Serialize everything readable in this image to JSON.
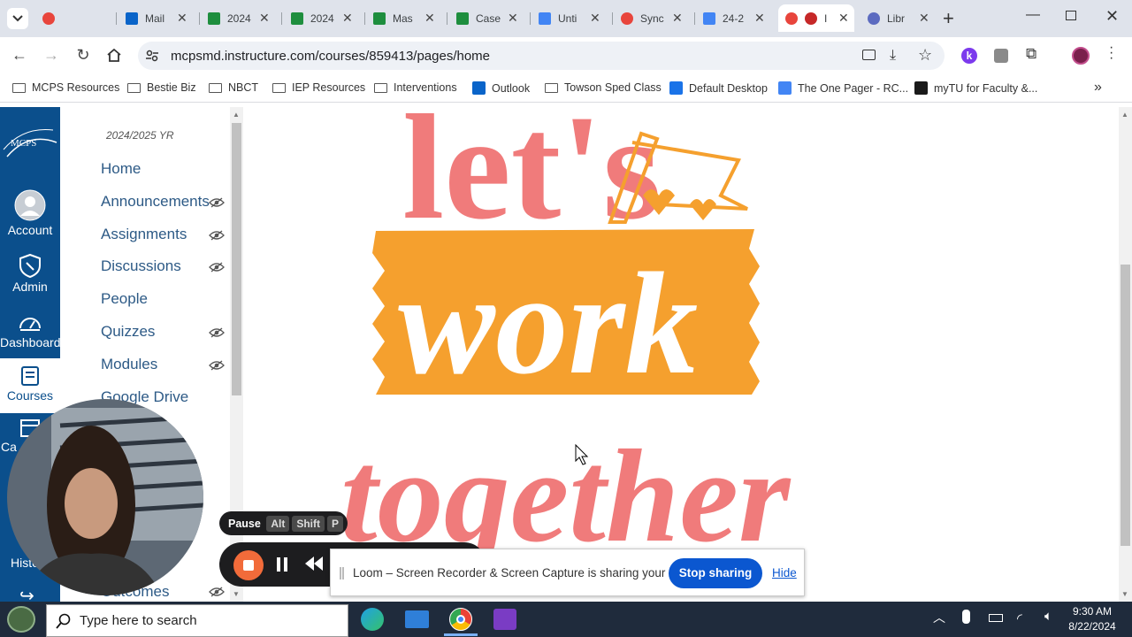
{
  "browser": {
    "tabs": [
      {
        "label": "",
        "fav": "loom-icon",
        "color": "#e8453c"
      },
      {
        "label": "Mail",
        "fav": "outlook-icon",
        "color": "#0a64c9"
      },
      {
        "label": "2024",
        "fav": "sheets-icon",
        "color": "#1e8e3e"
      },
      {
        "label": "2024",
        "fav": "sheets-icon",
        "color": "#1e8e3e"
      },
      {
        "label": "Mas",
        "fav": "sheets-icon",
        "color": "#1e8e3e"
      },
      {
        "label": "Case",
        "fav": "sheets-icon",
        "color": "#1e8e3e"
      },
      {
        "label": "Unti",
        "fav": "docs-icon",
        "color": "#4285f4"
      },
      {
        "label": "Sync",
        "fav": "sync-icon",
        "color": "#e8453c"
      },
      {
        "label": "24-2",
        "fav": "docs-icon",
        "color": "#4285f4"
      },
      {
        "label": "I",
        "fav": "canvas-icon",
        "color": "#e8453c"
      },
      {
        "label": "Libr",
        "fav": "gear-icon",
        "color": "#5c6bc0"
      }
    ],
    "url": "mcpsmd.instructure.com/courses/859413/pages/home",
    "bookmarks": [
      {
        "label": "MCPS Resources",
        "icon": "folder"
      },
      {
        "label": "Bestie Biz",
        "icon": "folder"
      },
      {
        "label": "NBCT",
        "icon": "folder"
      },
      {
        "label": "IEP Resources",
        "icon": "folder"
      },
      {
        "label": "Interventions",
        "icon": "folder"
      },
      {
        "label": "Outlook",
        "icon": "outlook"
      },
      {
        "label": "Towson Sped Class",
        "icon": "folder"
      },
      {
        "label": "Default Desktop",
        "icon": "desktop"
      },
      {
        "label": "The One Pager - RC...",
        "icon": "doc"
      },
      {
        "label": "myTU for Faculty &...",
        "icon": "tu"
      }
    ]
  },
  "global_nav": {
    "logo": "MCPS",
    "items": [
      {
        "label": "Account"
      },
      {
        "label": "Admin"
      },
      {
        "label": "Dashboard"
      },
      {
        "label": "Courses"
      }
    ],
    "partial": [
      "Ca",
      "Histo"
    ]
  },
  "course_nav": {
    "term": "2024/2025 YR",
    "items": [
      {
        "label": "Home",
        "hidden": false
      },
      {
        "label": "Announcements",
        "hidden": true
      },
      {
        "label": "Assignments",
        "hidden": true
      },
      {
        "label": "Discussions",
        "hidden": true
      },
      {
        "label": "People",
        "hidden": false
      },
      {
        "label": "Quizzes",
        "hidden": true
      },
      {
        "label": "Modules",
        "hidden": true
      },
      {
        "label": "Google Drive",
        "hidden": false
      },
      {
        "label": "Outcomes",
        "hidden": true
      }
    ]
  },
  "content": {
    "line1": "let's",
    "line2": "work",
    "line3": "together",
    "colors": {
      "pink": "#f07b7b",
      "orange": "#f5a02e"
    }
  },
  "loom": {
    "pause_label": "Pause",
    "keys": [
      "Alt",
      "Shift",
      "P"
    ],
    "banner_text": "Loom – Screen Recorder & Screen Capture is sharing your screen.",
    "stop_label": "Stop sharing",
    "hide_label": "Hide"
  },
  "taskbar": {
    "search_placeholder": "Type here to search",
    "time": "9:30 AM",
    "date": "8/22/2024"
  }
}
